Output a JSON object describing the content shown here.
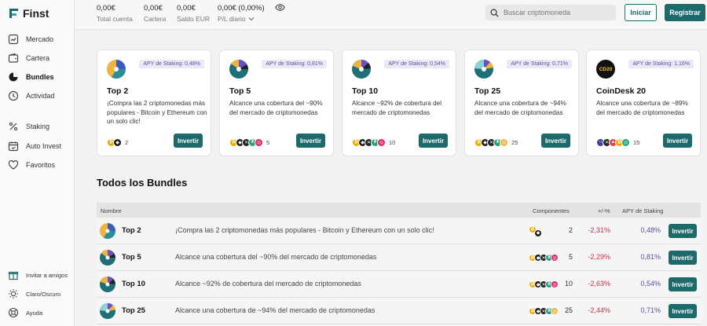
{
  "app": {
    "name": "Finst"
  },
  "sidebar": {
    "items": [
      {
        "label": "Mercado",
        "icon": "chart-icon"
      },
      {
        "label": "Cartera",
        "icon": "wallet-icon"
      },
      {
        "label": "Bundles",
        "icon": "pie-icon",
        "active": true
      },
      {
        "label": "Actividad",
        "icon": "clock-icon"
      },
      {
        "label": "Staking",
        "icon": "percent-icon"
      },
      {
        "label": "Auto Invest",
        "icon": "calendar-icon"
      },
      {
        "label": "Favoritos",
        "icon": "heart-icon"
      }
    ],
    "bottom": [
      {
        "label": "Invitar a amigos",
        "icon": "gift-icon"
      },
      {
        "label": "Claro/Oscuro",
        "icon": "sun-icon"
      },
      {
        "label": "Ayuda",
        "icon": "help-icon"
      }
    ]
  },
  "header": {
    "stats": [
      {
        "value": "0,00€",
        "label": "Total cuenta"
      },
      {
        "value": "0,00€",
        "label": "Cartera"
      },
      {
        "value": "0,00€",
        "label": "Saldo EUR"
      },
      {
        "value": "0,00€ (0,00%)",
        "label": "P/L diario"
      }
    ],
    "search_placeholder": "Buscar criptomoneda",
    "login_label": "Iniciar",
    "register_label": "Registrar"
  },
  "colors": {
    "accent": "#1c6a6a",
    "negative": "#c4314b",
    "apy": "#5a4ea0"
  },
  "bundles": [
    {
      "name": "Top 2",
      "apy": "APY de Staking: 0,48%",
      "desc": "¡Compra las 2 criptomonedas más populares - Bitcoin y Ethereum con un solo clic!",
      "count": "2",
      "invest": "Invertir"
    },
    {
      "name": "Top 5",
      "apy": "APY de Staking: 0,81%",
      "desc": "Alcance una cobertura del ~90% del mercado de criptomonedas",
      "count": "5",
      "invest": "Invertir"
    },
    {
      "name": "Top 10",
      "apy": "APY de Staking: 0,54%",
      "desc": "Alcance ~92% de cobertura del mercado de criptomonedas",
      "count": "10",
      "invest": "Invertir"
    },
    {
      "name": "Top 25",
      "apy": "APY de Staking: 0,71%",
      "desc": "Alcance una cobertura de ~94% del mercado de criptomonedas",
      "count": "25",
      "invest": "Invertir"
    },
    {
      "name": "CoinDesk 20",
      "icon_text": "CD20",
      "apy": "APY de Staking: 1,16%",
      "desc": "Alcance una cobertura de ~89% del mercado de criptomonedas",
      "count": "15",
      "invest": "Invertir"
    }
  ],
  "section_title": "Todos los Bundles",
  "table": {
    "headers": {
      "name": "Nombre",
      "components": "Componentes",
      "change": "+/-%",
      "apy": "APY de Staking"
    },
    "rows": [
      {
        "name": "Top 2",
        "desc": "¡Compra las 2 criptomonedas más populares - Bitcoin y Ethereum con un solo clic!",
        "count": "2",
        "change": "-2,31%",
        "apy": "0,48%",
        "invest": "Invertir"
      },
      {
        "name": "Top 5",
        "desc": "Alcance una cobertura del ~90% del mercado de criptomonedas",
        "count": "5",
        "change": "-2,29%",
        "apy": "0,81%",
        "invest": "Invertir"
      },
      {
        "name": "Top 10",
        "desc": "Alcance ~92% de cobertura del mercado de criptomonedas",
        "count": "10",
        "change": "-2,63%",
        "apy": "0,54%",
        "invest": "Invertir"
      },
      {
        "name": "Top 25",
        "desc": "Alcance una cobertura de ~94% del mercado de criptomonedas",
        "count": "25",
        "change": "-2,44%",
        "apy": "0,71%",
        "invest": "Invertir"
      }
    ]
  }
}
